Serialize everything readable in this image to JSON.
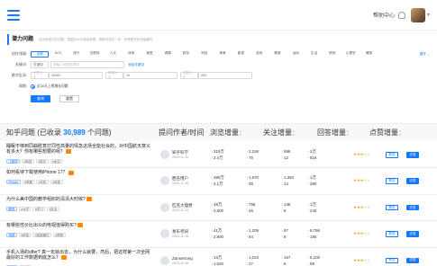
{
  "header": {
    "help_label": "帮助中心",
    "chevron": "▾"
  },
  "filter": {
    "title": "潜力问题",
    "hint": "找出有潜力的问题，根据近30天增量数据，帮助你抢先一步，获得更多的流量曝光",
    "category_label": "创作领域:",
    "categories": [
      "全部",
      "ACG",
      "旅行",
      "互联网",
      "人文",
      "体育",
      "家居",
      "健康",
      "财务",
      "科技",
      "美食",
      "影视",
      "游戏",
      "教育",
      "运动",
      "生活",
      "职场",
      "心理学",
      "情感"
    ],
    "active_category": "全部",
    "expand_label": "展开 ⌄",
    "keyword_label": "关键词:",
    "keyword_value": "关键词",
    "keyword_placeholder": "请输入问题关键词",
    "keyword_link": "添加关键词",
    "range_label": "数字区间:",
    "range_min_placeholder": "浏览大于",
    "range_min_value": "20000",
    "range_b_placeholder": "新增大于",
    "range_b_value": "10",
    "range_c_placeholder": "回答小于",
    "range_c_value": "200",
    "period_label": "周期:",
    "period_value": "近30天上榜增长问题",
    "search_label": "查询",
    "reset_label": "重置"
  },
  "table_header": {
    "question_prefix": "知乎问题 (已收录",
    "question_count": "30,989",
    "question_suffix": "个问题)",
    "author": "提问作者/时间",
    "views": "浏览增量",
    "follows": "关注增量",
    "answers": "回答增量",
    "likes": "点赞增量"
  },
  "rows": [
    {
      "question": "睡眠不够到同曲胜意打同性高量的情急这场全能社会的，对中国航天意义有多大？你有哪些想要的呢？",
      "chips": [
        "工程学",
        "#科技",
        "#航天",
        "#太空"
      ],
      "author": "知乎科学",
      "date": "2023-11-15",
      "views": "315万",
      "views_sub": "2.4万",
      "follows": "2,158",
      "follows_sub": "75",
      "answers": "596",
      "answers_sub": "12",
      "likes": "2万",
      "likes_sub": "516",
      "stars": 3
    },
    {
      "question": "如何看待下载使用iPhone 17？",
      "chips": [
        "iPhone",
        "#苹果",
        "#手机",
        "#科技"
      ],
      "author": "匿名用户",
      "date": "2023-11-16",
      "views": "380万",
      "views_sub": "3.1万",
      "follows": "1,570",
      "follows_sub": "38",
      "answers": "1,363",
      "answers_sub": "14",
      "likes": "1万",
      "likes_sub": "280",
      "stars": 3
    },
    {
      "question": "为什么美中国的教学组织的清清大时候?",
      "chips": [
        "教育",
        "#大学",
        "#学习",
        "#社会"
      ],
      "author": "匹克大理想",
      "date": "2023-11-15",
      "views": "48万",
      "views_sub": "3,600",
      "follows": "758",
      "follows_sub": "26",
      "answers": "136",
      "answers_sub": "8",
      "likes": "1万",
      "likes_sub": "240",
      "stars": 3
    },
    {
      "question": "有哪些性价比出众的电视值得购买?",
      "chips": [
        "电视",
        "#科技",
        "#智能硬件",
        "#购物"
      ],
      "author": "易乐考研",
      "date": "2023-11-15",
      "views": "41万",
      "views_sub": "2,900",
      "follows": "1,209",
      "follows_sub": "54",
      "answers": "97",
      "answers_sub": "9",
      "likes": "8,756",
      "likes_sub": "190",
      "stars": 3
    },
    {
      "question": "手机入场的offer? 真一年就出去，为什么就要，然后，把这样第一次全网最好的工作数据到底怎么？",
      "chips": [
        "职场",
        "#工作"
      ],
      "author": "Zansetrong",
      "date": "2023-11-16",
      "views": "13万",
      "views_sub": "1,020",
      "follows": "1,023",
      "follows_sub": "27",
      "answers": "157",
      "answers_sub": "6",
      "likes": "5,100",
      "likes_sub": "98",
      "stars": 3
    }
  ],
  "row_actions": {
    "preview": "预览",
    "go": "去答"
  },
  "colors": {
    "accent": "#1677ff",
    "up_arrow": "#f36b21",
    "star": "#f5a623"
  },
  "icons": {
    "menu": "menu-icon",
    "bell": "bell-icon",
    "up": "↑"
  }
}
